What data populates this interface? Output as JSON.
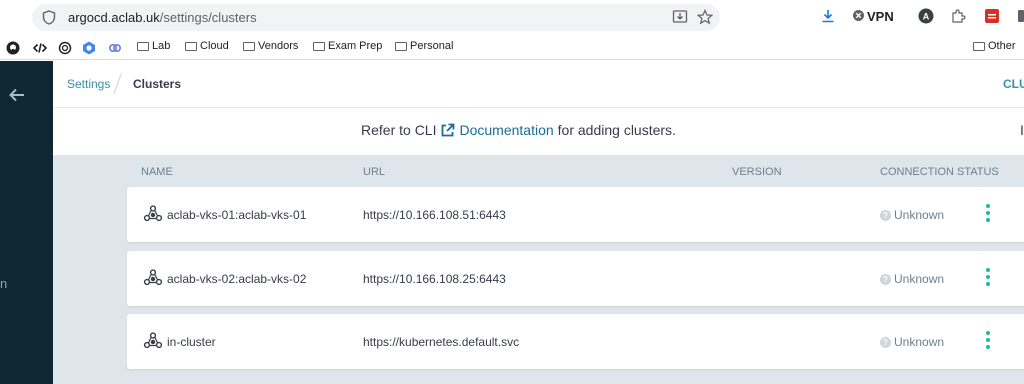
{
  "browser": {
    "url_domain": "argocd.aclab.uk",
    "url_path": "/settings/clusters",
    "vpn_label": "VPN",
    "bookmarks": [
      "Lab",
      "Cloud",
      "Vendors",
      "Exam Prep",
      "Personal"
    ],
    "other_bookmarks": "Other"
  },
  "sidebar": {
    "partial_label": "n"
  },
  "breadcrumb": {
    "settings": "Settings",
    "clusters": "Clusters"
  },
  "topbar": {
    "right_label": "CLU"
  },
  "info": {
    "prefix": "Refer to CLI",
    "link": "Documentation",
    "suffix": "for adding clusters.",
    "right_partial": "I"
  },
  "table": {
    "headers": {
      "name": "NAME",
      "url": "URL",
      "version": "VERSION",
      "status": "CONNECTION STATUS"
    },
    "rows": [
      {
        "name": "aclab-vks-01:aclab-vks-01",
        "url": "https://10.166.108.51:6443",
        "version": "",
        "status": "Unknown"
      },
      {
        "name": "aclab-vks-02:aclab-vks-02",
        "url": "https://10.166.108.25:6443",
        "version": "",
        "status": "Unknown"
      },
      {
        "name": "in-cluster",
        "url": "https://kubernetes.default.svc",
        "version": "",
        "status": "Unknown"
      }
    ]
  },
  "colors": {
    "sidebar": "#0f2733",
    "accent": "#18be94",
    "link": "#1a6e95",
    "content_bg": "#dee6eb"
  }
}
